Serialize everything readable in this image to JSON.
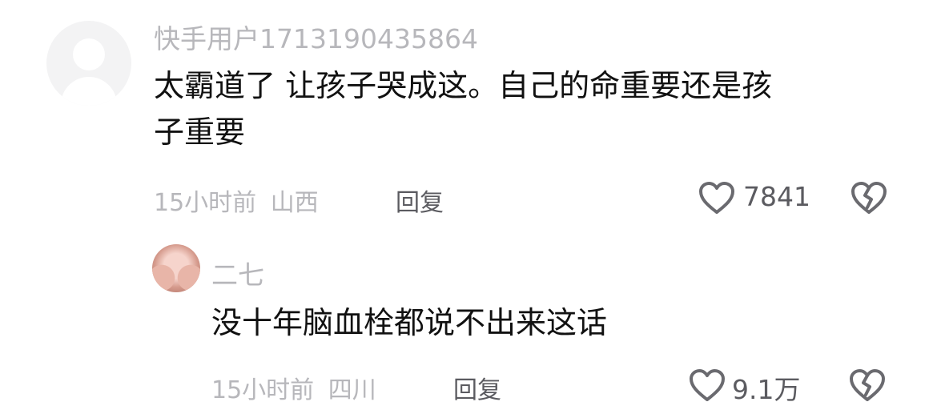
{
  "comment": {
    "username": "快手用户1713190435864",
    "text_line1": "太霸道了 让孩子哭成这。自己的命重要还是孩",
    "text_line2": "子重要",
    "time": "15小时前",
    "location": "山西",
    "reply_label": "回复",
    "like_count": "7841",
    "like_icon": "heart-outline-icon",
    "dislike_icon": "broken-heart-icon"
  },
  "reply": {
    "username": "二七",
    "text": "没十年脑血栓都说不出来这话",
    "time": "15小时前",
    "location": "四川",
    "reply_label": "回复",
    "like_count": "9.1万"
  }
}
